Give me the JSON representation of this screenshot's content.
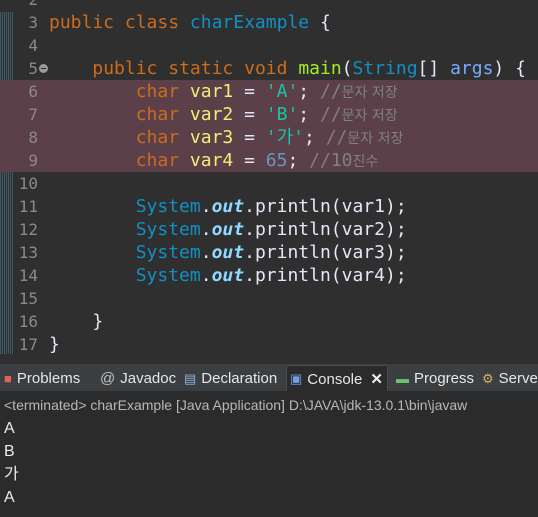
{
  "editor": {
    "lines": [
      {
        "num": "2"
      },
      {
        "num": "3",
        "tokens": [
          [
            "kw",
            "public"
          ],
          [
            "pl",
            " "
          ],
          [
            "kw",
            "class"
          ],
          [
            "pl",
            " "
          ],
          [
            "cls",
            "charExample"
          ],
          [
            "pl",
            " {"
          ]
        ]
      },
      {
        "num": "4"
      },
      {
        "num": "5",
        "fold": true,
        "tokens": [
          [
            "pl",
            "    "
          ],
          [
            "kw",
            "public"
          ],
          [
            "pl",
            " "
          ],
          [
            "kw",
            "static"
          ],
          [
            "pl",
            " "
          ],
          [
            "kw",
            "void"
          ],
          [
            "pl",
            " "
          ],
          [
            "fn",
            "main"
          ],
          [
            "pl",
            "("
          ],
          [
            "type",
            "String"
          ],
          [
            "pl",
            "[] "
          ],
          [
            "param",
            "args"
          ],
          [
            "pl",
            ") {"
          ]
        ]
      },
      {
        "num": "6",
        "selected": true,
        "tokens": [
          [
            "pl",
            "        "
          ],
          [
            "kw",
            "char"
          ],
          [
            "pl",
            " "
          ],
          [
            "var",
            "var1"
          ],
          [
            "pl",
            " = "
          ],
          [
            "str",
            "'A'"
          ],
          [
            "pl",
            "; "
          ],
          [
            "cmt",
            "//"
          ],
          [
            "cmt ko",
            "문자 저장"
          ]
        ]
      },
      {
        "num": "7",
        "selected": true,
        "tokens": [
          [
            "pl",
            "        "
          ],
          [
            "kw",
            "char"
          ],
          [
            "pl",
            " "
          ],
          [
            "var",
            "var2"
          ],
          [
            "pl",
            " = "
          ],
          [
            "str",
            "'B'"
          ],
          [
            "pl",
            "; "
          ],
          [
            "cmt",
            "//"
          ],
          [
            "cmt ko",
            "문자 저장"
          ]
        ]
      },
      {
        "num": "8",
        "selected": true,
        "tokens": [
          [
            "pl",
            "        "
          ],
          [
            "kw",
            "char"
          ],
          [
            "pl",
            " "
          ],
          [
            "var",
            "var3"
          ],
          [
            "pl",
            " = "
          ],
          [
            "str",
            "'가'"
          ],
          [
            "pl",
            "; "
          ],
          [
            "cmt",
            "//"
          ],
          [
            "cmt ko",
            "문자 저장"
          ]
        ]
      },
      {
        "num": "9",
        "selected": true,
        "tokens": [
          [
            "pl",
            "        "
          ],
          [
            "kw",
            "char"
          ],
          [
            "pl",
            " "
          ],
          [
            "var",
            "var4"
          ],
          [
            "pl",
            " = "
          ],
          [
            "num",
            "65"
          ],
          [
            "pl",
            "; "
          ],
          [
            "cmt",
            "//10"
          ],
          [
            "cmt ko",
            "진수"
          ]
        ]
      },
      {
        "num": "10"
      },
      {
        "num": "11",
        "tokens": [
          [
            "pl",
            "        "
          ],
          [
            "sys",
            "System"
          ],
          [
            "pl",
            "."
          ],
          [
            "out",
            "out"
          ],
          [
            "pl",
            "."
          ],
          [
            "pl",
            "println(var1);"
          ]
        ]
      },
      {
        "num": "12",
        "tokens": [
          [
            "pl",
            "        "
          ],
          [
            "sys",
            "System"
          ],
          [
            "pl",
            "."
          ],
          [
            "out",
            "out"
          ],
          [
            "pl",
            "."
          ],
          [
            "pl",
            "println(var2);"
          ]
        ]
      },
      {
        "num": "13",
        "tokens": [
          [
            "pl",
            "        "
          ],
          [
            "sys",
            "System"
          ],
          [
            "pl",
            "."
          ],
          [
            "out",
            "out"
          ],
          [
            "pl",
            "."
          ],
          [
            "pl",
            "println(var3);"
          ]
        ]
      },
      {
        "num": "14",
        "tokens": [
          [
            "pl",
            "        "
          ],
          [
            "sys",
            "System"
          ],
          [
            "pl",
            "."
          ],
          [
            "out",
            "out"
          ],
          [
            "pl",
            "."
          ],
          [
            "pl",
            "println(var4);"
          ]
        ]
      },
      {
        "num": "15"
      },
      {
        "num": "16",
        "tokens": [
          [
            "pl",
            "    }"
          ]
        ]
      },
      {
        "num": "17",
        "tokens": [
          [
            "pl",
            "}"
          ]
        ]
      }
    ]
  },
  "tabs": [
    {
      "label": "Problems",
      "icon": "problems-icon",
      "glyph": "🅿"
    },
    {
      "label": "Javadoc",
      "icon": "javadoc-icon",
      "glyph": "@"
    },
    {
      "label": "Declaration",
      "icon": "declaration-icon",
      "glyph": "▤"
    },
    {
      "label": "Console",
      "icon": "console-icon",
      "glyph": "▣",
      "active": true,
      "close": "✕"
    },
    {
      "label": "Progress",
      "icon": "progress-icon",
      "glyph": "▬"
    },
    {
      "label": "Server",
      "icon": "servers-icon",
      "glyph": "⚙"
    }
  ],
  "console": {
    "status": "<terminated> charExample [Java Application] D:\\JAVA\\jdk-13.0.1\\bin\\javaw",
    "output": [
      "A",
      "B",
      "가",
      "A"
    ]
  },
  "colors": {
    "keyword": "#cc6c1d",
    "string": "#17c6a3",
    "comment": "#808080",
    "field": "#f3ec79",
    "selected_line": "#5b4049"
  }
}
